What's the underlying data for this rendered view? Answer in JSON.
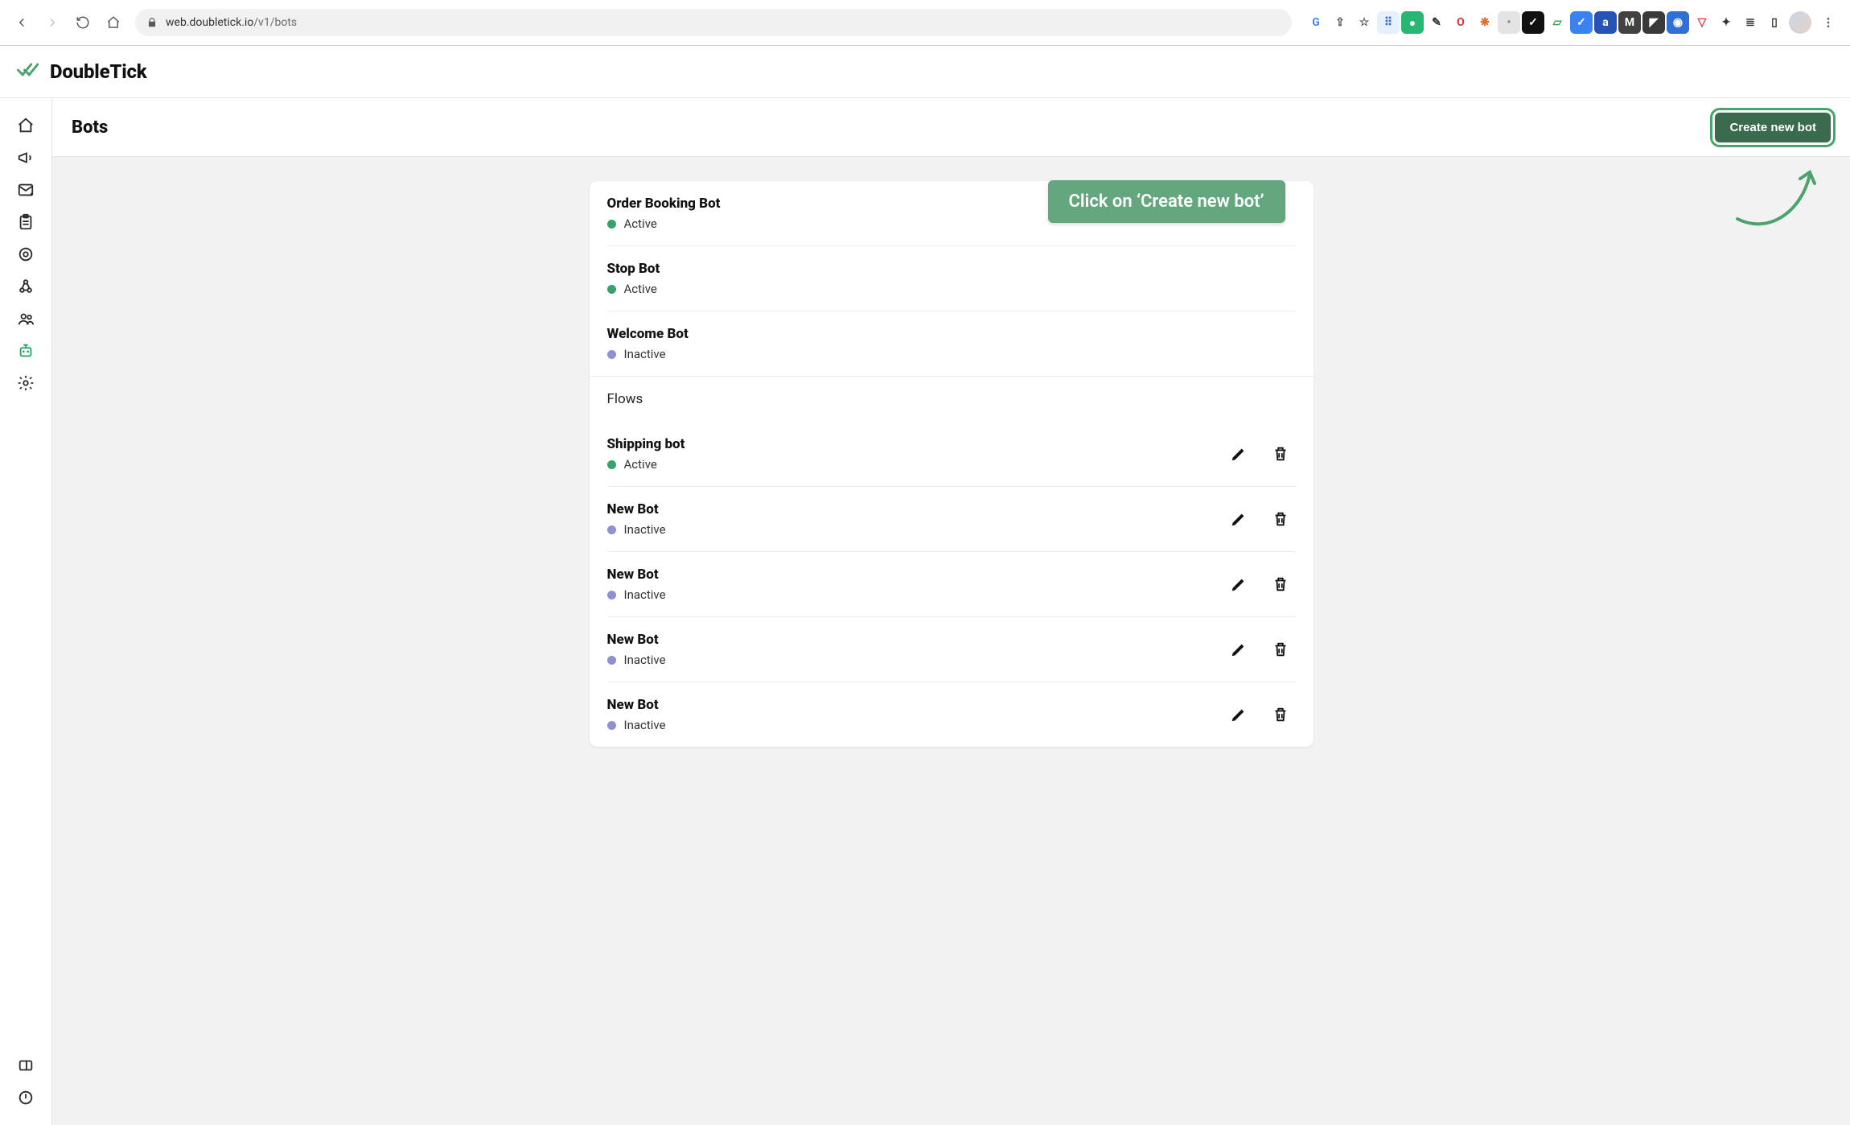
{
  "browser": {
    "url_host": "web.doubletick.io",
    "url_path": "/v1/bots",
    "ext_icons": [
      {
        "name": "google-icon",
        "bg": "#fff",
        "fg": "#4285F4",
        "glyph": "G"
      },
      {
        "name": "share-icon",
        "bg": "#fff",
        "fg": "#555",
        "glyph": "⇪"
      },
      {
        "name": "star-icon",
        "bg": "#fff",
        "fg": "#555",
        "glyph": "☆"
      },
      {
        "name": "translate-icon",
        "bg": "#e7f0fe",
        "fg": "#3a6cd4",
        "glyph": "⠿"
      },
      {
        "name": "grammarly-icon",
        "bg": "#29b673",
        "fg": "#fff",
        "glyph": "●"
      },
      {
        "name": "dropper-icon",
        "bg": "#fff",
        "fg": "#333",
        "glyph": "✎"
      },
      {
        "name": "opera-icon",
        "bg": "#fff",
        "fg": "#d5333a",
        "glyph": "O"
      },
      {
        "name": "crab-icon",
        "bg": "#fff",
        "fg": "#e06a22",
        "glyph": "❋"
      },
      {
        "name": "grey-dot-icon",
        "bg": "#e4e4e4",
        "fg": "#888",
        "glyph": "•"
      },
      {
        "name": "checkbox-icon",
        "bg": "#111",
        "fg": "#fff",
        "glyph": "✓"
      },
      {
        "name": "sheet-icon",
        "bg": "#fff",
        "fg": "#3aa34a",
        "glyph": "▱"
      },
      {
        "name": "todo-icon",
        "bg": "#3a82f0",
        "fg": "#fff",
        "glyph": "✓"
      },
      {
        "name": "a-icon",
        "bg": "#2653b5",
        "fg": "#fff",
        "glyph": "a"
      },
      {
        "name": "m-icon",
        "bg": "#424242",
        "fg": "#fff",
        "glyph": "M"
      },
      {
        "name": "flag-icon",
        "bg": "#3a3a3a",
        "fg": "#fff",
        "glyph": "◤"
      },
      {
        "name": "similarweb-icon",
        "bg": "#2e6fd8",
        "fg": "#fff",
        "glyph": "◉"
      },
      {
        "name": "pocket-icon",
        "bg": "#fff",
        "fg": "#e5374a",
        "glyph": "▽"
      },
      {
        "name": "puzzle-icon",
        "bg": "#fff",
        "fg": "#333",
        "glyph": "✦"
      },
      {
        "name": "playlist-icon",
        "bg": "#fff",
        "fg": "#333",
        "glyph": "≣"
      },
      {
        "name": "panel-icon",
        "bg": "#fff",
        "fg": "#333",
        "glyph": "▯"
      }
    ]
  },
  "app": {
    "name": "DoubleTick"
  },
  "sidebar": [
    {
      "icon": "home-icon"
    },
    {
      "icon": "megaphone-icon"
    },
    {
      "icon": "mail-plus-icon"
    },
    {
      "icon": "clipboard-icon"
    },
    {
      "icon": "target-icon"
    },
    {
      "icon": "webhook-icon"
    },
    {
      "icon": "people-icon"
    },
    {
      "icon": "bot-icon",
      "active": true
    },
    {
      "icon": "gear-icon"
    }
  ],
  "sidebar_bottom": [
    {
      "icon": "card-icon"
    },
    {
      "icon": "power-icon"
    }
  ],
  "page": {
    "title": "Bots",
    "create_label": "Create new bot"
  },
  "annotation": {
    "text": "Click on ‘Create new bot’"
  },
  "bots_top": [
    {
      "name": "Order Booking Bot",
      "status": "Active",
      "status_type": "active"
    },
    {
      "name": "Stop Bot",
      "status": "Active",
      "status_type": "active"
    },
    {
      "name": "Welcome Bot",
      "status": "Inactive",
      "status_type": "inactive"
    }
  ],
  "section_label": "Flows",
  "flows": [
    {
      "name": "Shipping bot",
      "status": "Active",
      "status_type": "active"
    },
    {
      "name": "New Bot",
      "status": "Inactive",
      "status_type": "inactive"
    },
    {
      "name": "New Bot",
      "status": "Inactive",
      "status_type": "inactive"
    },
    {
      "name": "New Bot",
      "status": "Inactive",
      "status_type": "inactive"
    },
    {
      "name": "New Bot",
      "status": "Inactive",
      "status_type": "inactive"
    }
  ]
}
